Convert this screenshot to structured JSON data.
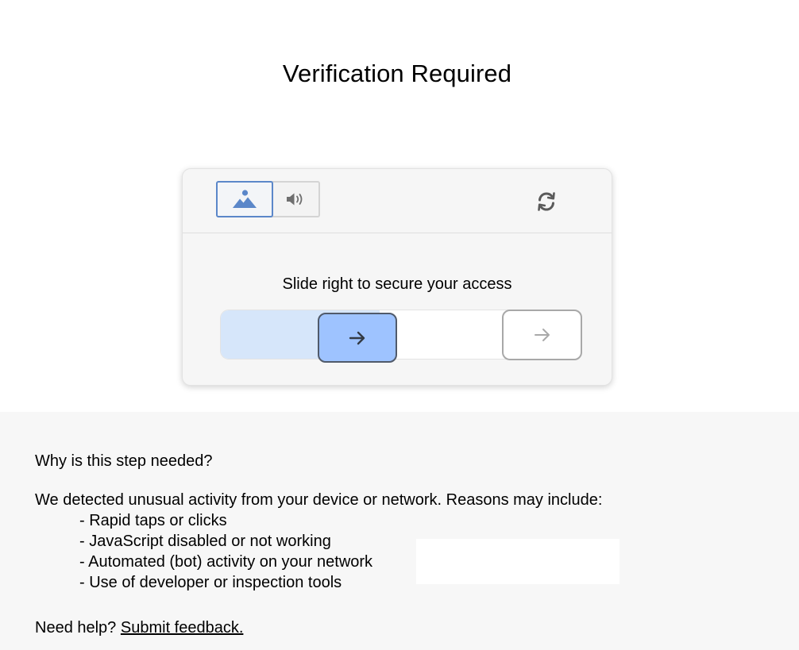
{
  "page": {
    "title": "Verification Required"
  },
  "captcha": {
    "modes": {
      "image_icon": "image-mountain-icon",
      "audio_icon": "speaker-icon",
      "active": "image"
    },
    "refresh_icon": "refresh-icon",
    "instruction": "Slide right to secure your access",
    "slider": {
      "handle_icon": "arrow-right-icon",
      "target_icon": "arrow-right-icon",
      "progress": 0.44
    },
    "colors": {
      "accent": "#5b87c9",
      "handle": "#9ec3ff",
      "fill": "#d6e6fa"
    }
  },
  "info": {
    "heading": "Why is this step needed?",
    "intro": "We detected unusual activity from your device or network. Reasons may include:",
    "reasons": [
      "- Rapid taps or clicks",
      "- JavaScript disabled or not working",
      "- Automated (bot) activity on your network",
      "- Use of developer or inspection tools"
    ],
    "help_prefix": "Need help?",
    "help_link": "Submit feedback."
  }
}
